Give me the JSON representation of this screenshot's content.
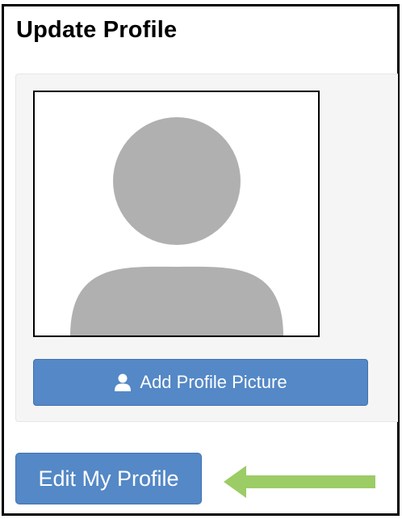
{
  "page": {
    "title": "Update Profile"
  },
  "profile_picture": {
    "placeholder_icon": "avatar-silhouette-icon",
    "add_button_icon": "user-icon",
    "add_button_label": "Add Profile Picture"
  },
  "actions": {
    "edit_profile_label": "Edit My Profile",
    "annotation_icon": "green-left-arrow-icon"
  },
  "colors": {
    "button_blue": "#5488c6",
    "panel_bg": "#f5f5f5",
    "avatar_gray": "#b0b0b0",
    "arrow_green": "#9ccc65"
  }
}
